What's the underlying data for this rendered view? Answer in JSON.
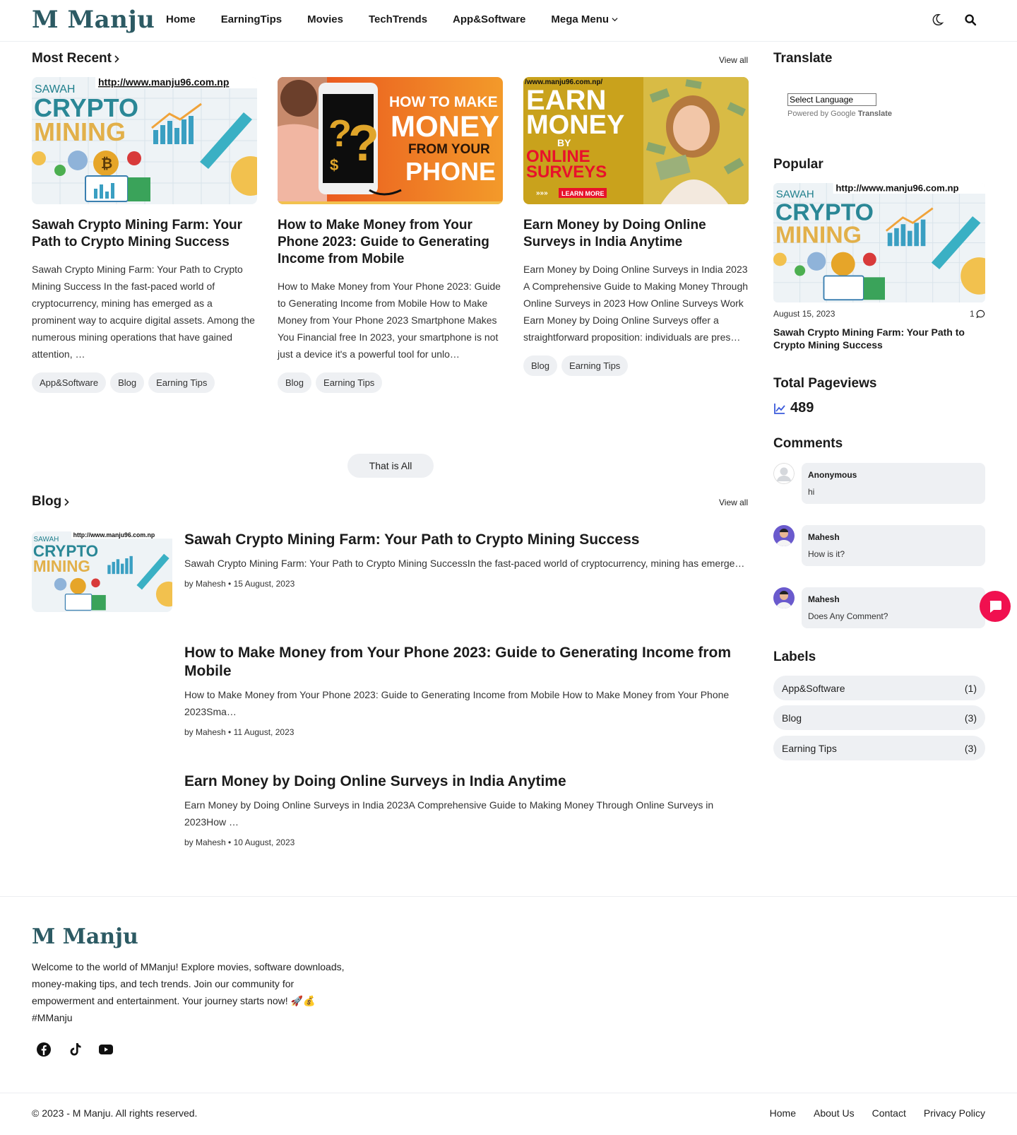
{
  "header": {
    "logo": "M Manju",
    "nav": [
      "Home",
      "EarningTips",
      "Movies",
      "TechTrends",
      "App&Software",
      "Mega Menu"
    ]
  },
  "most_recent": {
    "title": "Most Recent",
    "view_all": "View all",
    "posts": [
      {
        "title": "Sawah Crypto Mining Farm: Your Path to Crypto Mining Success",
        "excerpt": "Sawah Crypto Mining Farm: Your Path to Crypto Mining Success In the fast-paced world of cryptocurrency, mining has emerged as a prominent way to acquire digital assets. Among the numerous mining operations that have gained attention, …",
        "tags": [
          "App&Software",
          "Blog",
          "Earning Tips"
        ],
        "thumb": {
          "url": "http://www.manju96.com.np",
          "line1": "SAWAH",
          "line2": "CRYPTO",
          "line3": "MINING"
        }
      },
      {
        "title": "How to Make Money from Your Phone 2023: Guide to Generating Income from Mobile",
        "excerpt": "How to Make Money from Your Phone 2023: Guide to Generating Income from Mobile  How to Make Money from Your Phone 2023 Smartphone Makes You Financial free In 2023, your smartphone is not just a device it's a powerful tool for unlo…",
        "tags": [
          "Blog",
          "Earning Tips"
        ],
        "thumb": {
          "line1": "HOW TO MAKE",
          "line2": "MONEY",
          "line3": "FROM YOUR",
          "line4": "PHONE"
        }
      },
      {
        "title": "Earn Money by Doing Online Surveys in India Anytime",
        "excerpt": "Earn Money by Doing Online Surveys in India 2023 A Comprehensive Guide to Making Money Through Online Surveys in 2023 How Online Surveys Work Earn Money by Doing Online Surveys offer a straightforward proposition: individuals are pres…",
        "tags": [
          "Blog",
          "Earning Tips"
        ],
        "thumb": {
          "url": "/www.manju96.com.np/",
          "line1": "EARN",
          "line2": "MONEY",
          "line3": "BY",
          "line4": "ONLINE",
          "line5": "SURVEYS",
          "cta": "LEARN MORE"
        }
      }
    ],
    "end_label": "That is All"
  },
  "blog": {
    "title": "Blog",
    "view_all": "View all",
    "posts": [
      {
        "title": "Sawah Crypto Mining Farm: Your Path to Crypto Mining Success",
        "excerpt": "Sawah Crypto Mining Farm: Your Path to Crypto Mining SuccessIn the fast-paced world of cryptocurrency, mining has emerge…",
        "meta": "by Mahesh • 15 August, 2023",
        "thumb": {
          "url": "http://www.manju96.com.np",
          "line1": "SAWAH",
          "line2": "CRYPTO",
          "line3": "MINING"
        }
      },
      {
        "title": "How to Make Money from Your Phone 2023: Guide to Generating Income from Mobile",
        "excerpt": "How to Make Money from Your Phone 2023: Guide to Generating Income from Mobile How to Make Money from Your Phone 2023Sma…",
        "meta": "by Mahesh • 11 August, 2023"
      },
      {
        "title": "Earn Money by Doing Online Surveys in India Anytime",
        "excerpt": "Earn Money by Doing Online Surveys in India 2023A Comprehensive Guide to Making Money Through Online Surveys in 2023How …",
        "meta": "by Mahesh • 10 August, 2023"
      }
    ]
  },
  "sidebar": {
    "translate": {
      "title": "Translate",
      "select": "Select Language",
      "powered_by": "Powered by",
      "google": "Google",
      "translate": "Translate"
    },
    "popular": {
      "title": "Popular",
      "date": "August 15, 2023",
      "comments": "1",
      "post_title": "Sawah Crypto Mining Farm: Your Path to Crypto Mining Success",
      "thumb": {
        "url": "http://www.manju96.com.np",
        "line1": "SAWAH",
        "line2": "CRYPTO",
        "line3": "MINING"
      }
    },
    "pageviews": {
      "title": "Total Pageviews",
      "value": "489"
    },
    "comments": {
      "title": "Comments",
      "items": [
        {
          "name": "Anonymous",
          "text": "hi"
        },
        {
          "name": "Mahesh",
          "text": "How is it?"
        },
        {
          "name": "Mahesh",
          "text": "Does Any Comment?"
        }
      ]
    },
    "labels": {
      "title": "Labels",
      "items": [
        {
          "name": "App&Software",
          "count": "(1)"
        },
        {
          "name": "Blog",
          "count": "(3)"
        },
        {
          "name": "Earning Tips",
          "count": "(3)"
        }
      ]
    }
  },
  "footer": {
    "logo": "M Manju",
    "about": "Welcome to the world of MManju! Explore movies, software downloads, money-making tips, and tech trends. Join our community for empowerment and entertainment. Your journey starts now! 🚀💰 #MManju",
    "copyright": "© 2023 - M Manju. All rights reserved.",
    "links": [
      "Home",
      "About Us",
      "Contact",
      "Privacy Policy"
    ]
  },
  "colors": {
    "accent": "#f0104f",
    "chip_bg": "#eef0f3",
    "pageviews_icon": "#3b5bdb"
  }
}
